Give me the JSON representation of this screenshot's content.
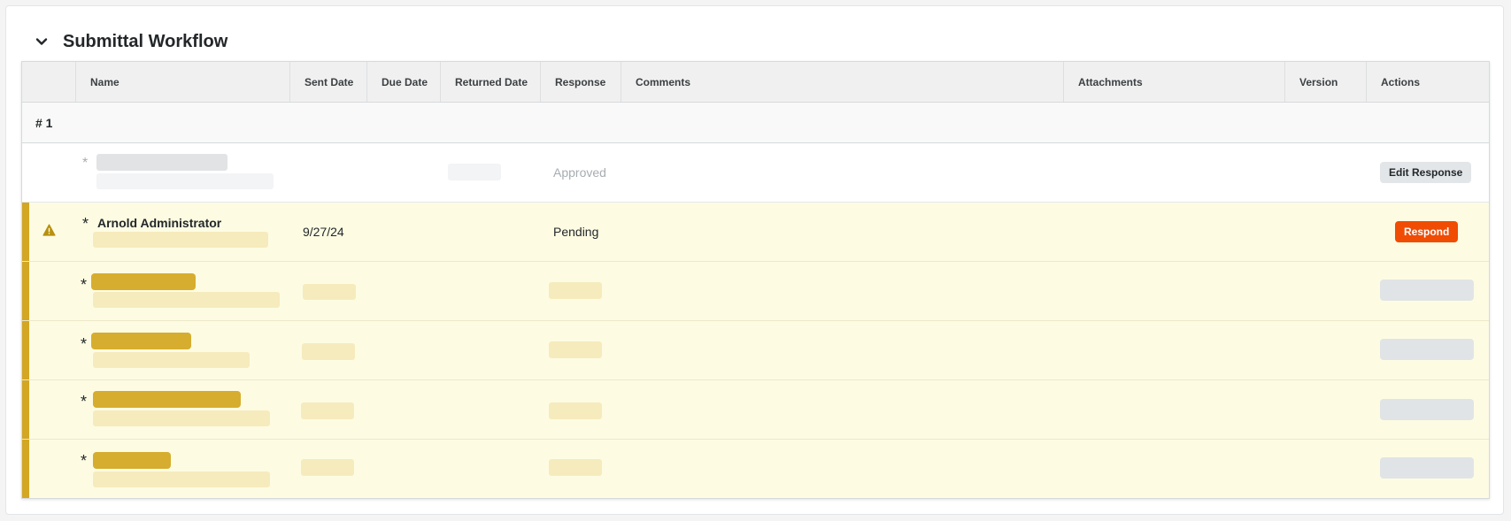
{
  "section": {
    "title": "Submittal Workflow",
    "collapse_icon": "chevron-down-icon"
  },
  "table": {
    "columns": [
      "",
      "Name",
      "Sent Date",
      "Due Date",
      "Returned Date",
      "Response",
      "Comments",
      "Attachments",
      "Version",
      "Actions"
    ],
    "group_label": "# 1",
    "required_marker": "*",
    "rows": [
      {
        "state": "completed",
        "name": "",
        "response": "Approved",
        "action": "Edit Response"
      },
      {
        "state": "current",
        "name": "Arnold Administrator",
        "sent_date": "9/27/24",
        "response": "Pending",
        "action": "Respond",
        "status_icon": "warning-icon"
      },
      {
        "state": "current-pending"
      },
      {
        "state": "current-pending"
      },
      {
        "state": "current-pending"
      },
      {
        "state": "current-pending"
      }
    ]
  },
  "colors": {
    "accent_gold": "#d3a623",
    "highlight_row": "#fdfce3",
    "respond_button": "#f04c04",
    "warning_icon": "#b8900f"
  }
}
